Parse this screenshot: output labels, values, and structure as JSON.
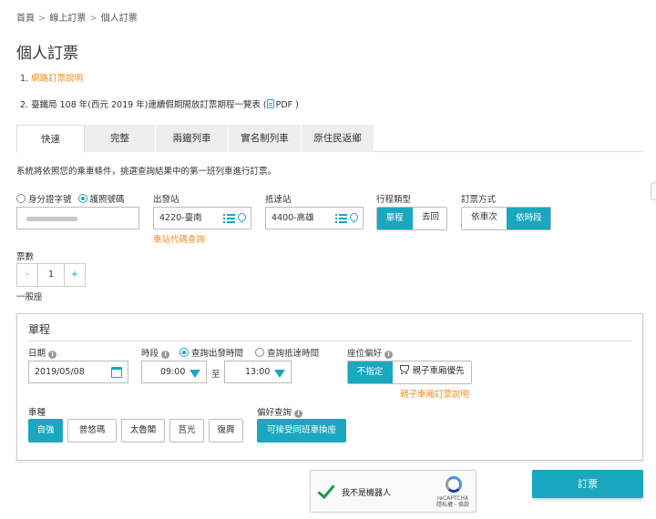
{
  "breadcrumb": [
    "首頁",
    "線上訂票",
    "個人訂票"
  ],
  "page_title": "個人訂票",
  "notes": {
    "n1_prefix": "1. ",
    "n1_link": "網路訂票說明",
    "n2_text": "2. 臺鐵局 108 年(西元 2019 年)連續假期開放訂票期程一覽表 (",
    "n2_pdf": "PDF )"
  },
  "tabs": [
    "快速",
    "完整",
    "兩鐵列車",
    "實名制列車",
    "原住民返鄉"
  ],
  "description": "系統將依照您的乘車條件，挑選查詢結果中的第一班列車進行訂票。",
  "id_type": {
    "option_id": "身分證字號",
    "option_passport": "護照號碼"
  },
  "departure": {
    "label": "出發站",
    "value": "4220-臺南",
    "code_link": "車站代碼查詢"
  },
  "arrival": {
    "label": "抵達站",
    "value": "4400-高雄"
  },
  "trip_type": {
    "label": "行程類型",
    "one_way": "單程",
    "round_trip": "去回"
  },
  "booking_method": {
    "label": "訂票方式",
    "by_train": "依車次",
    "by_time": "依時段"
  },
  "tickets": {
    "label": "票數",
    "minus": "-",
    "value": "1",
    "plus": "+",
    "seat_class": "一般座"
  },
  "panel": {
    "title": "單程",
    "date_label": "日期",
    "date_value": "2019/05/08",
    "time_label": "時段",
    "depart_time_option": "查詢出發時間",
    "arrive_time_option": "查詢抵達時間",
    "time_from": "09:00",
    "time_to_word": "至",
    "time_to": "13:00",
    "seat_pref_label": "座位偏好",
    "seat_no_pref": "不指定",
    "seat_family": "親子車廂優先",
    "family_link": "親子車廂訂票說明",
    "train_type_label": "車種",
    "train_types": [
      "自強",
      "普悠瑪",
      "太魯閣",
      "莒光",
      "復興"
    ],
    "pref_query_label": "偏好查詢",
    "pref_query_button": "可接受同班車換座"
  },
  "captcha": {
    "label": "我不是機器人",
    "brand": "reCAPTCHA",
    "terms": "隱私權 - 條款"
  },
  "submit": "訂票",
  "colors": {
    "accent": "#1aa7c0",
    "link": "#f08c1e"
  }
}
